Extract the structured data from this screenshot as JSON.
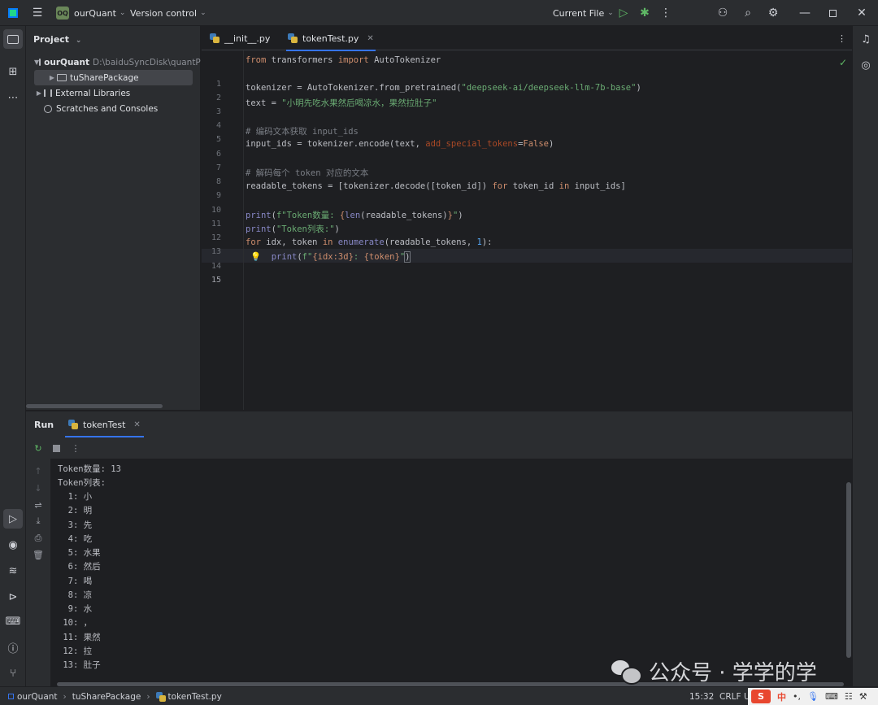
{
  "titlebar": {
    "project_badge": "OQ",
    "project_name": "ourQuant",
    "vcs_label": "Version control",
    "run_config": "Current File"
  },
  "project_panel": {
    "title": "Project",
    "tree": [
      {
        "label": "ourQuant",
        "path": "D:\\baiduSyncDisk\\quantPrj"
      },
      {
        "label": "tuSharePackage"
      },
      {
        "label": "External Libraries"
      },
      {
        "label": "Scratches and Consoles"
      }
    ]
  },
  "editor": {
    "tabs": [
      {
        "label": "__init__.py"
      },
      {
        "label": "tokenTest.py"
      }
    ],
    "line_numbers": [
      "1",
      "2",
      "3",
      "4",
      "5",
      "6",
      "7",
      "8",
      "9",
      "10",
      "11",
      "12",
      "13",
      "14",
      "15"
    ],
    "code": {
      "l1_from": "from",
      "l1_mod": " transformers ",
      "l1_import": "import",
      "l1_name": " AutoTokenizer",
      "l3_a": "tokenizer = AutoTokenizer.from_pretrained(",
      "l3_str": "\"deepseek-ai/deepseek-llm-7b-base\"",
      "l3_b": ")",
      "l4_a": "text = ",
      "l4_str": "\"小明先吃水果然后喝凉水，果然拉肚子\"",
      "l6_cm": "# 编码文本获取 input_ids",
      "l7_a": "input_ids = tokenizer.encode(text, ",
      "l7_param": "add_special_tokens",
      "l7_eq": "=",
      "l7_kw": "False",
      "l7_b": ")",
      "l9_cm": "# 解码每个 token 对应的文本",
      "l10_a": "readable_tokens = [tokenizer.decode([token_id]) ",
      "l10_for": "for",
      "l10_b": " token_id ",
      "l10_in": "in",
      "l10_c": " input_ids]",
      "l12_print": "print",
      "l12_a": "(",
      "l12_str": "f\"Token数量: ",
      "l12_b": "{",
      "l12_len": "len",
      "l12_c": "(readable_tokens)",
      "l12_d": "}",
      "l12_str2": "\"",
      "l12_e": ")",
      "l13_print": "print",
      "l13_a": "(",
      "l13_str": "\"Token列表:\"",
      "l13_b": ")",
      "l14_for": "for",
      "l14_a": " idx, token ",
      "l14_in": "in",
      "l14_enum": " enumerate",
      "l14_b": "(readable_tokens, ",
      "l14_num": "1",
      "l14_c": "):",
      "l15_print": "print",
      "l15_a": "(",
      "l15_str": "f\"",
      "l15_b": "{idx:3d}",
      "l15_str2": ": ",
      "l15_c": "{token}",
      "l15_str3": "\"",
      "l15_d": ")"
    }
  },
  "run": {
    "label": "Run",
    "tab": "tokenTest",
    "output": [
      "Token数量: 13",
      "Token列表:",
      "  1: 小",
      "  2: 明",
      "  3: 先",
      "  4: 吃",
      "  5: 水果",
      "  6: 然后",
      "  7: 喝",
      "  8: 凉",
      "  9: 水",
      " 10: ，",
      " 11: 果然",
      " 12: 拉",
      " 13: 肚子"
    ]
  },
  "statusbar": {
    "crumbs": [
      "ourQuant",
      "tuSharePackage",
      "tokenTest.py"
    ],
    "position": "15:32",
    "line_sep": "CRLF",
    "encoding_partial": "U"
  },
  "ime": {
    "logo": "S",
    "lang": "中"
  },
  "watermark": {
    "text": "公众号 · 学学的学"
  },
  "colors": {
    "accent": "#3574f0",
    "keyword": "#cf8e6d",
    "string": "#6aab73",
    "comment": "#7a7e85"
  }
}
